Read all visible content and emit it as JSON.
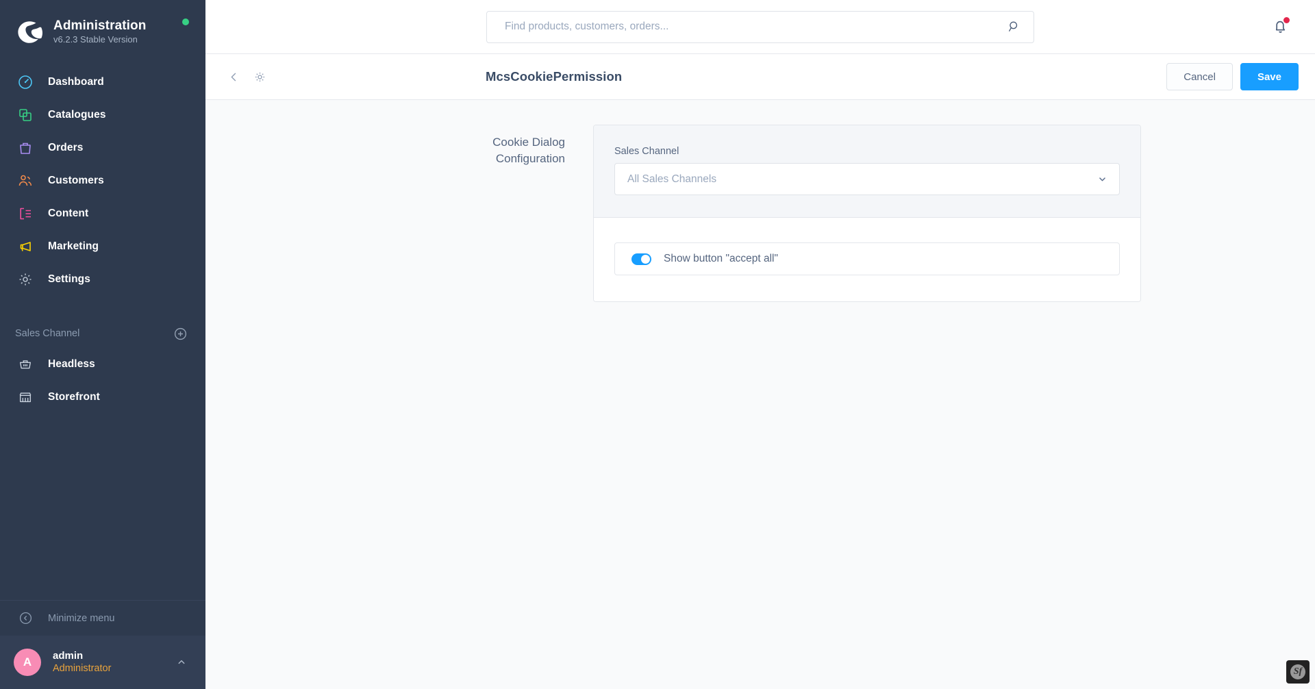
{
  "sidebar": {
    "brand": {
      "logo_icon": "shopware-logo-icon",
      "title": "Administration",
      "version": "v6.2.3 Stable Version",
      "status_color": "#37d084"
    },
    "nav_items": [
      {
        "label": "Dashboard",
        "icon": "dashboard-icon",
        "color": "#4dc6f5"
      },
      {
        "label": "Catalogues",
        "icon": "catalogues-icon",
        "color": "#37d084"
      },
      {
        "label": "Orders",
        "icon": "orders-icon",
        "color": "#a88cf0"
      },
      {
        "label": "Customers",
        "icon": "customers-icon",
        "color": "#f08a4b"
      },
      {
        "label": "Content",
        "icon": "content-icon",
        "color": "#f34f9e"
      },
      {
        "label": "Marketing",
        "icon": "marketing-icon",
        "color": "#ffd400"
      },
      {
        "label": "Settings",
        "icon": "gear-icon",
        "color": "#b5bfcc"
      }
    ],
    "section": {
      "label": "Sales Channel",
      "add_icon": "plus-circle-icon"
    },
    "channels": [
      {
        "label": "Headless",
        "icon": "basket-icon"
      },
      {
        "label": "Storefront",
        "icon": "storefront-icon"
      }
    ],
    "minimize": {
      "label": "Minimize menu",
      "icon": "chevron-left-circle-icon"
    },
    "user": {
      "avatar_initial": "A",
      "avatar_color": "#f88cb5",
      "name": "admin",
      "role": "Administrator",
      "role_color": "#e9a33c",
      "chevron_icon": "chevron-up-icon"
    }
  },
  "topbar": {
    "search": {
      "placeholder": "Find products, customers, orders...",
      "value": "",
      "icon": "search-icon"
    },
    "notifications": {
      "icon": "bell-icon",
      "has_unread": true,
      "dot_color": "#e3264c"
    }
  },
  "subbar": {
    "back_icon": "chevron-left-icon",
    "settings_icon": "gear-icon",
    "title": "McsCookiePermission",
    "cancel_label": "Cancel",
    "save_label": "Save",
    "save_color": "#189eff"
  },
  "main": {
    "card_label": "Cookie Dialog Configuration",
    "sales_channel": {
      "label": "Sales Channel",
      "value": "All Sales Channels",
      "chevron_icon": "chevron-down-icon"
    },
    "accept_all_switch": {
      "label": "Show button \"accept all\"",
      "enabled": true,
      "on_color": "#189eff"
    }
  },
  "debug_toolbar": {
    "icon": "symfony-icon",
    "glyph": "Sf"
  }
}
